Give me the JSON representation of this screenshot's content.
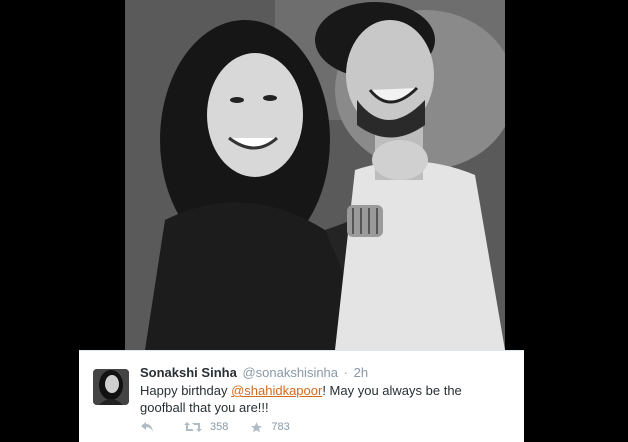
{
  "tweet": {
    "name": "Sonakshi Sinha",
    "handle": "@sonakshisinha",
    "separator": "·",
    "time": "2h",
    "text_before": "Happy birthday ",
    "mention": "@shahidkapoor",
    "text_after": "! May you always be the goofball that you are!!!",
    "retweets": "358",
    "favorites": "783"
  },
  "icons": {
    "reply": "reply-icon",
    "retweet": "retweet-icon",
    "favorite": "star-icon"
  },
  "colors": {
    "mention": "#d2691e",
    "muted": "#8899a6",
    "background": "#000000"
  }
}
